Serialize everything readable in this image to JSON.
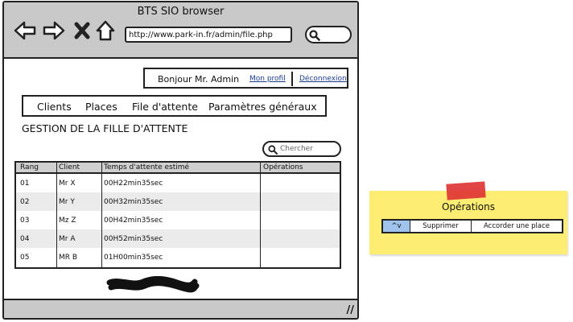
{
  "browser": {
    "title": "BTS SIO browser",
    "url": "http://www.park-in.fr/admin/file.php"
  },
  "user_bar": {
    "greeting": "Bonjour Mr. Admin",
    "profile_link": "Mon profil",
    "logout_link": "Déconnexion"
  },
  "menu": [
    "Clients",
    "Places",
    "File d'attente",
    "Paramètres généraux"
  ],
  "page_title": "GESTION DE LA FILLE D'ATTENTE",
  "search": {
    "placeholder": "Chercher"
  },
  "table": {
    "headers": [
      "Rang",
      "Client",
      "Temps d'attente estimé",
      "Opérations"
    ],
    "rows": [
      [
        "01",
        "Mr X",
        "00H22min35sec",
        ""
      ],
      [
        "02",
        "Mr Y",
        "00H32min35sec",
        ""
      ],
      [
        "03",
        "Mz Z",
        "00H42min35sec",
        ""
      ],
      [
        "04",
        "Mr A",
        "00H52min35sec",
        ""
      ],
      [
        "05",
        "MR B",
        "01H00min35sec",
        ""
      ]
    ]
  },
  "note": {
    "title": "Opérations",
    "buttons": [
      "^v",
      "Supprimer",
      "Accorder une place"
    ]
  },
  "colors": {
    "chrome_gray": "#c9c9c9",
    "note_yellow": "#fdee73",
    "tape_red": "#e03535",
    "selected_button": "#9fc3ec",
    "link_blue": "#1a3d8f"
  }
}
